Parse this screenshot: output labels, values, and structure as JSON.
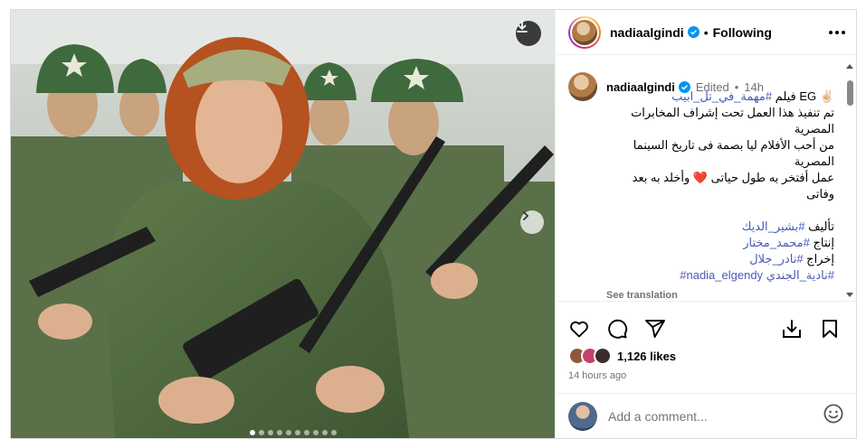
{
  "post": {
    "media": {
      "alt_icon_download": "download-icon",
      "alt_icon_next": "chevron-right-icon",
      "carousel_count": 10,
      "carousel_active_index": 0
    },
    "header": {
      "username": "nadiaalgindi",
      "separator": "•",
      "follow_label": "Following"
    },
    "caption": {
      "username": "nadiaalgindi",
      "edited": "Edited",
      "dot": "•",
      "time": "14h",
      "line1_pre": "✌🏻 EG فيلم ",
      "line1_tag": "#مهمة_في_تل_ابيب",
      "line2": "تم تنفيذ هذا العمل تحت إشراف المخابرات المصرية",
      "line3": "من أحب الأفلام ليا بصمة فى تاريخ السينما المصرية",
      "line4": "عمل أفتخر به طول حياتى ❤️ وأخلد به بعد وفاتى",
      "credit1_label": "تأليف ",
      "credit1_tag": "#بشير_الديك",
      "credit2_label": "إنتاج ",
      "credit2_tag": "#محمد_مختار",
      "credit3_label": "إخراج ",
      "credit3_tag": "#نادر_جلال",
      "tags_tag1": "#نادية_الجندي",
      "tags_tag2": "#nadia_elgendy",
      "see_translation": "See translation"
    },
    "likes": {
      "count_text": "1,126 likes"
    },
    "timestamp": "14 hours ago",
    "comment": {
      "placeholder": "Add a comment..."
    },
    "colors": {
      "hashtag": "#4a5ab5",
      "verified": "#0095f6",
      "heart_red": "#d0263b"
    }
  }
}
